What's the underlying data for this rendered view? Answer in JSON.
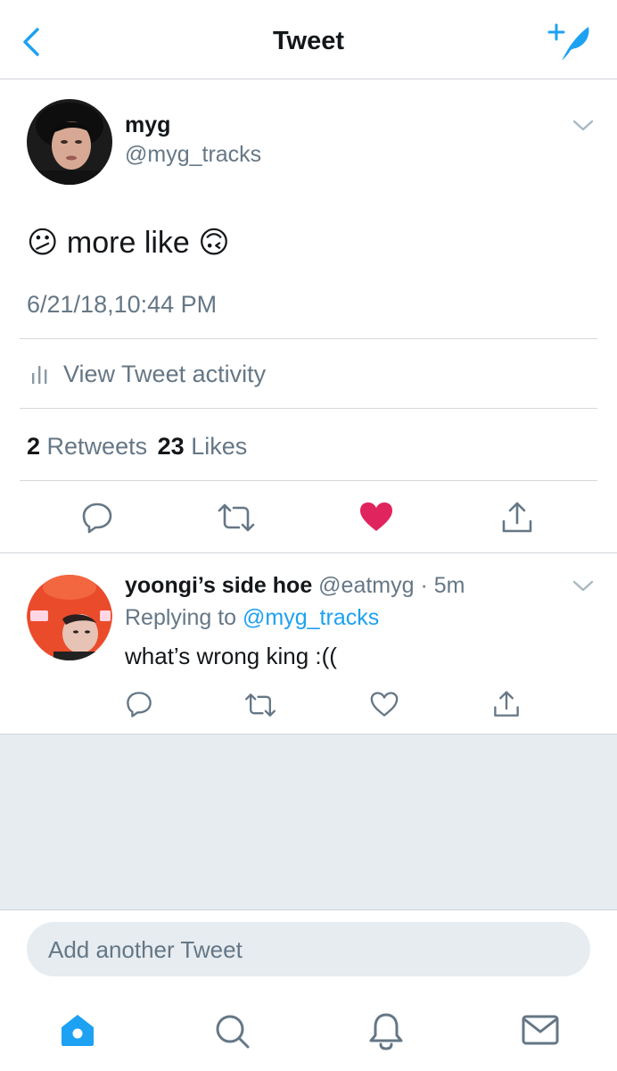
{
  "header": {
    "title": "Tweet",
    "back_icon": "chevron-left-icon",
    "compose_icon": "compose-feather-icon"
  },
  "tweet": {
    "author_name": "myg",
    "author_handle": "@myg_tracks",
    "text": "more like",
    "emoji_before": "😕",
    "emoji_after": "🙃",
    "timestamp": "6/21/18,10:44 PM",
    "activity_label": "View Tweet activity",
    "retweets_count": "2",
    "retweets_label": "Retweets",
    "likes_count": "23",
    "likes_label": "Likes",
    "liked": true
  },
  "reply": {
    "author_name": "yoongi’s side hoe",
    "author_handle": "@eatmyg",
    "separator": "·",
    "time": "5m",
    "replying_prefix": "Replying to",
    "replying_handle": "@myg_tracks",
    "text": "what’s wrong king :(("
  },
  "composer": {
    "placeholder": "Add another Tweet"
  },
  "tabbar": {
    "items": [
      "home-icon",
      "search-icon",
      "notifications-bell-icon",
      "messages-envelope-icon"
    ],
    "active": "home-icon"
  },
  "colors": {
    "accent": "#1da1f2",
    "like": "#e0245e",
    "muted": "#657786",
    "divider": "#d5d8dc",
    "background_gray": "#e6ecf0"
  }
}
